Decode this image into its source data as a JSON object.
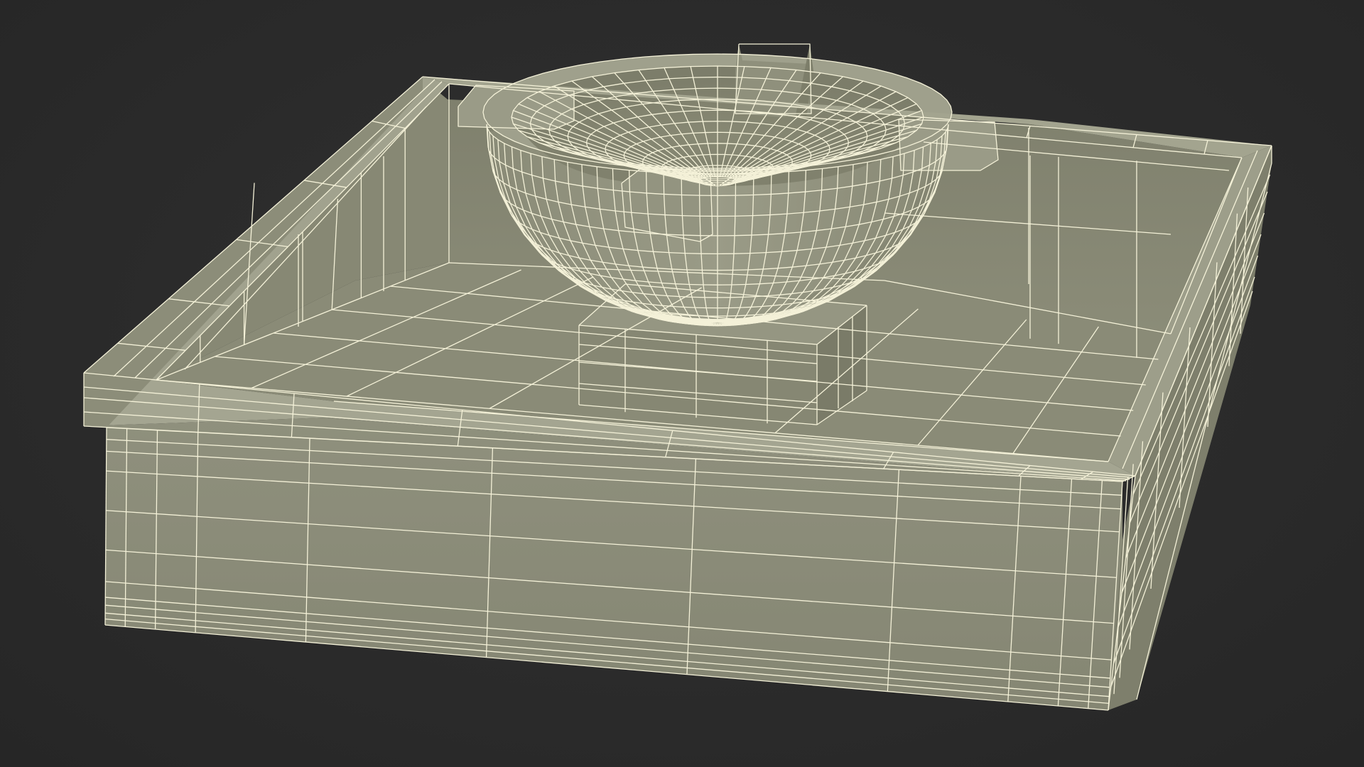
{
  "viewport": {
    "background": "#2b2b2b",
    "model_fill": "#8e8f7c",
    "model_fill_light": "#9c9d89",
    "model_fill_dark": "#777866",
    "wire_color": "#f4f1d8"
  },
  "model": {
    "parts": [
      "outer-box",
      "inner-floor",
      "pedestal",
      "ashtray-bowl",
      "cigarette-rests"
    ],
    "rest_count": 4,
    "icon": "wireframe-mesh"
  }
}
